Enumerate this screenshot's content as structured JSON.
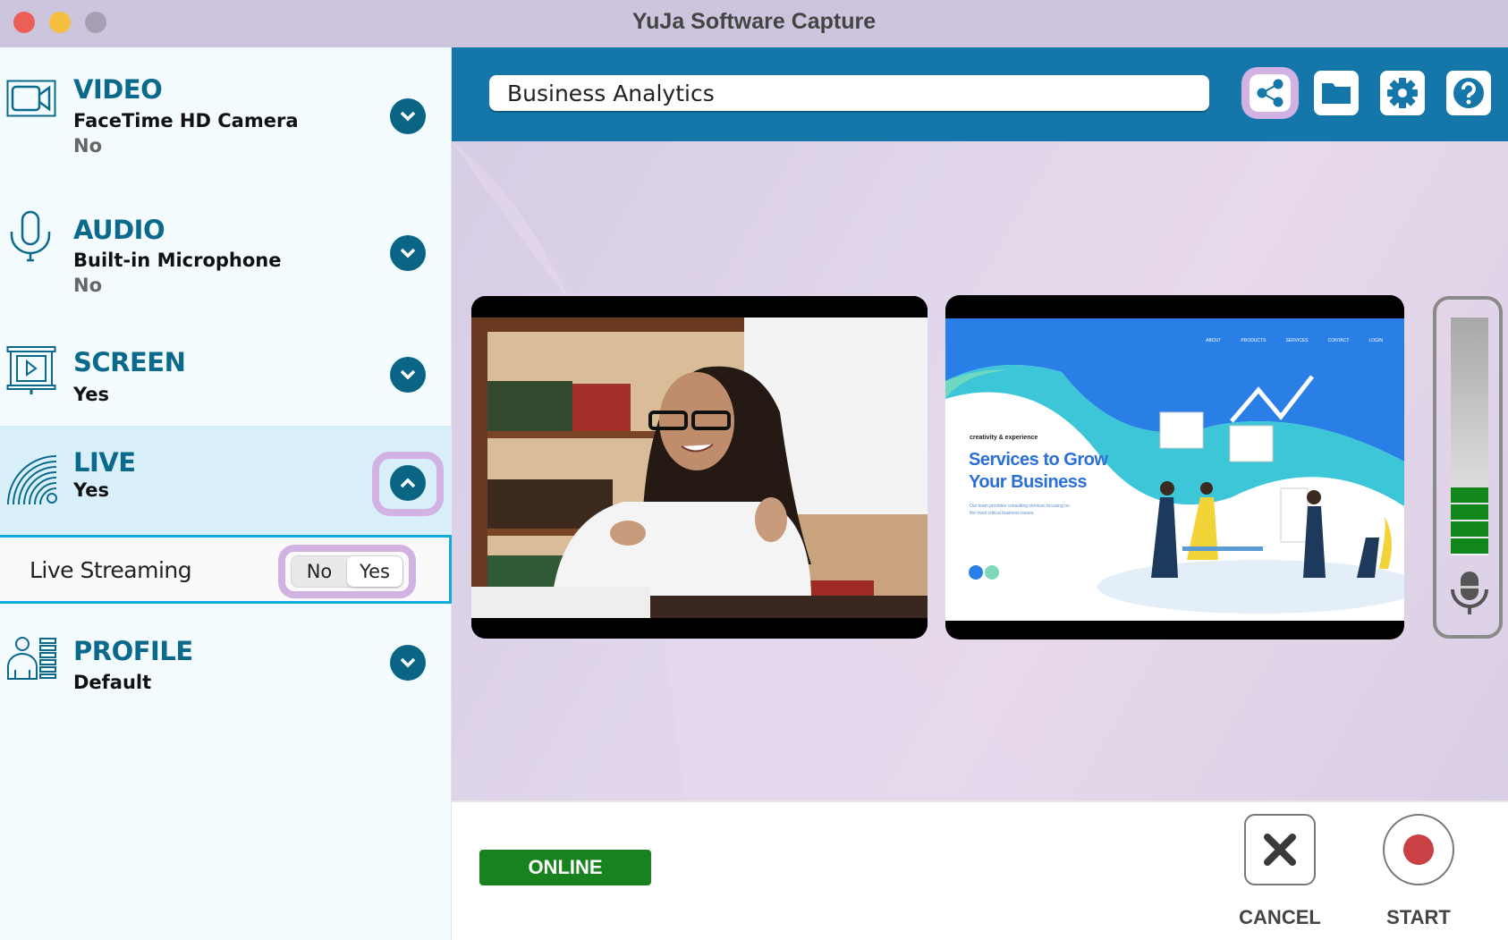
{
  "window": {
    "title": "YuJa Software Capture"
  },
  "sidebar": {
    "video": {
      "heading": "VIDEO",
      "device": "FaceTime HD Camera",
      "status": "No"
    },
    "audio": {
      "heading": "AUDIO",
      "device": "Built-in Microphone",
      "status": "No"
    },
    "screen": {
      "heading": "SCREEN",
      "status": "Yes"
    },
    "live": {
      "heading": "LIVE",
      "status": "Yes",
      "expanded": true,
      "streaming": {
        "label": "Live Streaming",
        "options": [
          "No",
          "Yes"
        ],
        "selected": "Yes"
      }
    },
    "profile": {
      "heading": "PROFILE",
      "value": "Default"
    }
  },
  "header": {
    "session_title": "Business Analytics",
    "buttons": [
      "share-icon",
      "folder-icon",
      "gear-icon",
      "help-icon"
    ]
  },
  "preview": {
    "slide": {
      "nav": [
        "ABOUT",
        "PRODUCTS",
        "SERVICES",
        "CONTACT",
        "LOGIN"
      ],
      "tagline": "creativity & experience",
      "headline1": "Services to Grow",
      "headline2": "Your Business",
      "body": "Our team provides consulting services focusing on the most critical business issues."
    },
    "audio_meter": {
      "segments_total": 14,
      "segments_lit": 4,
      "lit_color": "#11861b"
    }
  },
  "footer": {
    "status": "ONLINE",
    "status_color": "#18821e",
    "cancel_label": "CANCEL",
    "start_label": "START",
    "record_color": "#c94045"
  },
  "colors": {
    "accent": "#0b6a8c",
    "header": "#1476a9",
    "highlight": "#d2b1e3"
  }
}
